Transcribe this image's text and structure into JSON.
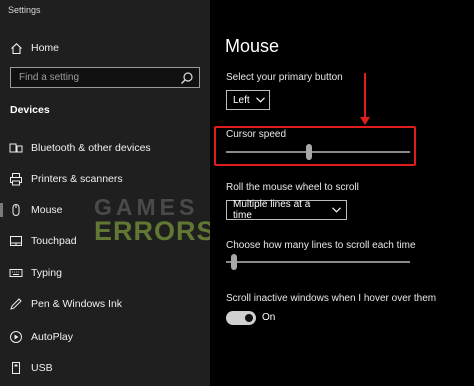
{
  "app_title": "Settings",
  "sidebar": {
    "home_label": "Home",
    "search_placeholder": "Find a setting",
    "section_title": "Devices",
    "items": [
      {
        "label": "Bluetooth & other devices",
        "icon": "bluetooth-icon"
      },
      {
        "label": "Printers & scanners",
        "icon": "printer-icon"
      },
      {
        "label": "Mouse",
        "icon": "mouse-icon",
        "active": true
      },
      {
        "label": "Touchpad",
        "icon": "touchpad-icon"
      },
      {
        "label": "Typing",
        "icon": "keyboard-icon"
      },
      {
        "label": "Pen & Windows Ink",
        "icon": "pen-icon"
      },
      {
        "label": "AutoPlay",
        "icon": "autoplay-icon"
      },
      {
        "label": "USB",
        "icon": "usb-icon"
      }
    ]
  },
  "main": {
    "title": "Mouse",
    "primary_button_label": "Select your primary button",
    "primary_button_value": "Left",
    "cursor_speed_label": "Cursor speed",
    "cursor_speed_value": 0.45,
    "scroll_label": "Roll the mouse wheel to scroll",
    "scroll_value": "Multiple lines at a time",
    "lines_label": "Choose how many lines to scroll each time",
    "lines_value": 0.03,
    "inactive_scroll_label": "Scroll inactive windows when I hover over them",
    "toggle_state": "On"
  },
  "watermark": {
    "line1": "GAMES",
    "line2": "ERRORS"
  },
  "colors": {
    "sidebar_bg": "#1f1f1f",
    "main_bg": "#000000",
    "highlight": "#e01d1d",
    "watermark_green": "#78963c"
  }
}
